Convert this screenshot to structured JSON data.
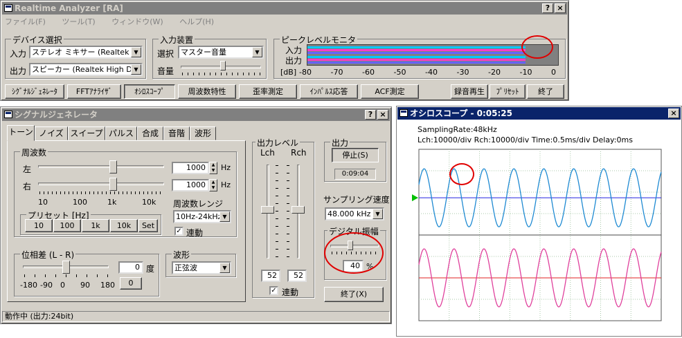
{
  "main": {
    "title": "Realtime Analyzer [RA]",
    "help_btn": "?",
    "close_btn": "×",
    "menu": [
      "ファイル(F)",
      "ツール(T)",
      "ウィンドウ(W)",
      "ヘルプ(H)"
    ],
    "device": {
      "label": "デバイス選択",
      "input_label": "入力",
      "input_value": "ステレオ ミキサー (Realtek",
      "output_label": "出力",
      "output_value": "スピーカー (Realtek High D"
    },
    "input_device": {
      "label": "入力装置",
      "select_label": "選択",
      "select_value": "マスター音量",
      "volume_label": "音量",
      "volume_level": 0.52
    },
    "peak": {
      "label": "ピークレベルモニタ",
      "in_label": "入力",
      "out_label": "出力",
      "db_label": "[dB]",
      "scale": [
        "-80",
        "-70",
        "-60",
        "-50",
        "-40",
        "-30",
        "-20",
        "-10",
        "0"
      ],
      "level_fraction": 0.87,
      "colors": {
        "cyan": "#00c8ff",
        "magenta": "#ff3cc8",
        "blue": "#6464ff"
      }
    },
    "toolbar_left": [
      "ｼｸﾞﾅﾙｼﾞｪﾈﾚｰﾀ",
      "FFTｱﾅﾗｲｻﾞ",
      "ｵｼﾛｽｺｰﾌﾟ",
      "周波数特性",
      "歪率測定",
      "ｲﾝﾊﾟﾙｽ応答",
      "ACF測定"
    ],
    "toolbar_right": [
      "録音再生",
      "ﾌﾟﾘｾｯﾄ",
      "終了"
    ]
  },
  "siggen": {
    "title": "シグナルジェネレータ",
    "tabs": [
      "トーン",
      "ノイズ",
      "スイープ",
      "パルス",
      "合成",
      "音階",
      "波形"
    ],
    "freq": {
      "label": "周波数",
      "left_label": "左",
      "right_label": "右",
      "left_value": "1000",
      "right_value": "1000",
      "unit": "Hz",
      "scale": [
        "10",
        "100",
        "1k",
        "10k"
      ],
      "slider_fraction": 0.6
    },
    "range": {
      "label": "周波数レンジ",
      "value": "10Hz-24kHz",
      "link_label": "連動",
      "link_checked": true
    },
    "preset": {
      "label": "プリセット [Hz]",
      "buttons": [
        "10",
        "100",
        "1k",
        "10k",
        "Set"
      ]
    },
    "phase": {
      "label": "位相差 (L - R)",
      "value": "0",
      "unit": "度",
      "reset": "0",
      "scale": [
        "-180",
        "-90",
        "0",
        "90",
        "180"
      ],
      "slider_fraction": 0.5
    },
    "waveform": {
      "label": "波形",
      "value": "正弦波"
    },
    "outlevel": {
      "label": "出力レベル",
      "lch": "Lch",
      "rch": "Rch",
      "lch_value": "52",
      "rch_value": "52",
      "link_label": "連動",
      "link_checked": true,
      "level_fraction": 0.52
    },
    "output": {
      "label": "出力",
      "stop_btn": "停止(S)",
      "time": "0:09:04"
    },
    "sampling": {
      "label": "サンプリング速度",
      "value": "48.000 kHz"
    },
    "digital": {
      "label": "デジタル振幅",
      "value": "40",
      "unit": "%",
      "level_fraction": 0.4
    },
    "exit_btn": "終了(X)",
    "status": "動作中 (出力:24bit)"
  },
  "scope": {
    "title": "オシロスコープ - 0:05:25",
    "info1": "SamplingRate:48kHz",
    "info2": "Lch:10000/div   Rch:10000/div   Time:0.5ms/div   Delay:0ms",
    "lch_color": "#1e8ad2",
    "rch_color": "#e0409c",
    "lch_center_color": "#2020e0",
    "rch_center_color": "#e02020"
  }
}
